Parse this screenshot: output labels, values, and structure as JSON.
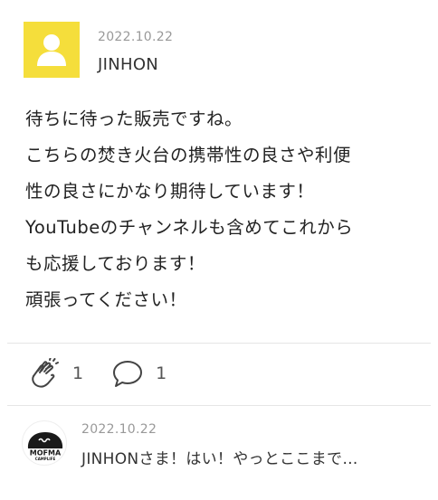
{
  "comment": {
    "date": "2022.10.22",
    "author": "JINHON",
    "avatar_icon": "user-silhouette-icon",
    "avatar_color": "#f5de3b",
    "body_lines": [
      "待ちに待った販売ですね。",
      "こちらの焚き火台の携帯性の良さや利便",
      "性の良さにかなり期待しています！",
      "YouTubeのチャンネルも含めてこれから",
      "も応援しております！",
      "頑張ってください！"
    ]
  },
  "actions": {
    "clap": {
      "icon": "clap-hands-icon",
      "count": "1"
    },
    "reply": {
      "icon": "speech-bubble-icon",
      "count": "1"
    }
  },
  "reply": {
    "date": "2022.10.22",
    "avatar_text_top": "MOFMA",
    "avatar_text_bottom": "CAMPLIFE",
    "preview": "JINHONさま！はい！やっとここまで…"
  }
}
